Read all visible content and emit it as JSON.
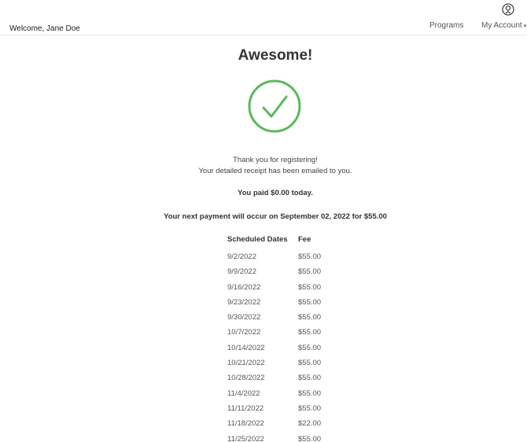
{
  "header": {
    "welcome": "Welcome, Jane Doe",
    "nav_programs": "Programs",
    "account_label": "My Account",
    "account_icon": "user-circle-icon"
  },
  "main": {
    "title": "Awesome!",
    "success_icon": "check-circle-icon",
    "thanks_line1": "Thank you for registering!",
    "thanks_line2": "Your detailed receipt has been emailed to you.",
    "paid": "You paid $0.00 today.",
    "next_payment": "Your next payment will occur on September 02, 2022 for $55.00"
  },
  "schedule": {
    "headers": {
      "date": "Scheduled Dates",
      "fee": "Fee"
    },
    "rows": [
      {
        "date": "9/2/2022",
        "fee": "$55.00"
      },
      {
        "date": "9/9/2022",
        "fee": "$55.00"
      },
      {
        "date": "9/16/2022",
        "fee": "$55.00"
      },
      {
        "date": "9/23/2022",
        "fee": "$55.00"
      },
      {
        "date": "9/30/2022",
        "fee": "$55.00"
      },
      {
        "date": "10/7/2022",
        "fee": "$55.00"
      },
      {
        "date": "10/14/2022",
        "fee": "$55.00"
      },
      {
        "date": "10/21/2022",
        "fee": "$55.00"
      },
      {
        "date": "10/28/2022",
        "fee": "$55.00"
      },
      {
        "date": "11/4/2022",
        "fee": "$55.00"
      },
      {
        "date": "11/11/2022",
        "fee": "$55.00"
      },
      {
        "date": "11/18/2022",
        "fee": "$22.00"
      },
      {
        "date": "11/25/2022",
        "fee": "$55.00"
      }
    ]
  },
  "colors": {
    "success_green": "#5cb85c",
    "text": "#333333",
    "muted": "#555555"
  }
}
